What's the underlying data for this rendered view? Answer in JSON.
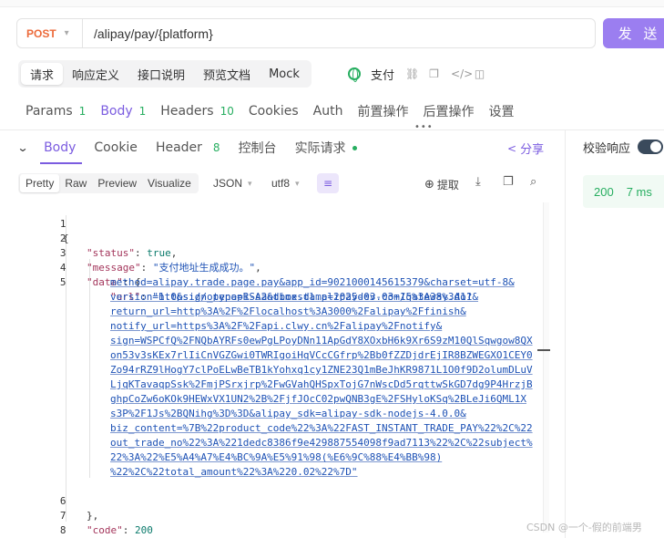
{
  "request": {
    "method": "POST",
    "url": "/alipay/pay/{platform}",
    "send_label": "发 送"
  },
  "primary_tabs": [
    "请求",
    "响应定义",
    "接口说明",
    "预览文档",
    "Mock"
  ],
  "primary_tools": {
    "env_label": "支付"
  },
  "request_tabs": [
    {
      "label": "Params",
      "count": "1"
    },
    {
      "label": "Body",
      "count": "1"
    },
    {
      "label": "Headers",
      "count": "10"
    },
    {
      "label": "Cookies",
      "count": ""
    },
    {
      "label": "Auth",
      "count": ""
    },
    {
      "label": "前置操作",
      "count": ""
    },
    {
      "label": "后置操作",
      "count": ""
    },
    {
      "label": "设置",
      "count": ""
    }
  ],
  "response_tabs": [
    {
      "label": "Body",
      "count": ""
    },
    {
      "label": "Cookie",
      "count": ""
    },
    {
      "label": "Header",
      "count": "8"
    },
    {
      "label": "控制台",
      "count": ""
    },
    {
      "label": "实际请求",
      "count": ""
    }
  ],
  "share_label": "分享",
  "validate": {
    "label": "校验响应",
    "enabled": true
  },
  "stats": {
    "status": "200",
    "time": "7 ms"
  },
  "format_tabs": [
    "Pretty",
    "Raw",
    "Preview",
    "Visualize"
  ],
  "format_select": {
    "format": "JSON",
    "encoding": "utf8"
  },
  "extract_label": "提取",
  "code": {
    "line_numbers": [
      "1",
      "2",
      "3",
      "4",
      "5",
      "6",
      "7",
      "8"
    ],
    "open_brace": "{",
    "status_key": "\"status\"",
    "status_val": "true",
    "message_key": "\"message\"",
    "message_val": "\"支付地址生成成功。\"",
    "data_key": "\"data\"",
    "url_key": "\"url\"",
    "url_lines": [
      "\"https://openapi-sandbox.dl.alipaydev.com/gateway.do?",
      "method=alipay.trade.page.pay&app_id=9021000145615379&charset=utf-8&",
      "version=1.0&sign_type=RSA2&timestamp=2025-03-03+15%3A38%3A11&",
      "return_url=http%3A%2F%2Flocalhost%3A3000%2Falipay%2Ffinish&",
      "notify_url=https%3A%2F%2Fapi.clwy.cn%2Falipay%2Fnotify&",
      "sign=WSPCfQ%2FNQbAYRFs0ewPgLPoyDNn11ApGdY8XOxbH6k9Xr6S9zM10QlSqwgow8QX",
      "on53v3sKEx7rlIiCnVGZGwi0TWRIgoiHqVCcCGfrp%2Bb0fZZDjdrEjIR8BZWEGXO1CEY0",
      "Zo94rRZ9lHogY7clPoELwBeTB1kYohxq1cy1ZNE23Q1mBeJhKR9871L1O0f9D2olumDLuV",
      "LjqKTavaqpSsk%2FmjPSrxjrp%2FwGVahQHSpxTojG7nWscDd5rqttwSkGD7dg9P4HrzjB",
      "ghpCoZw6oKOk9HEWxVX1UN2%2B%2FjfJOcC02pwQNB3gE%2FSHyloKSq%2BLeJi6QML1X",
      "s3P%2F1Js%2BQNihg%3D%3D&alipay_sdk=alipay-sdk-nodejs-4.0.0&",
      "biz_content=%7B%22product_code%22%3A%22FAST_INSTANT_TRADE_PAY%22%2C%22",
      "out_trade_no%22%3A%221dedc8386f9e429887554098f9ad7113%22%2C%22subject%",
      "22%3A%22%E5%A4%A7%E4%BC%9A%E5%91%98(%E6%9C%88%E4%BB%98)",
      "%22%2C%22total_amount%22%3A%220.02%22%7D\""
    ],
    "close_data": "},",
    "code_key": "\"code\"",
    "code_val": "200",
    "close_brace": "}"
  },
  "watermark": "CSDN @一个-假的前端男",
  "colors": {
    "accent": "#7b5ce0",
    "method": "#ec6a3a",
    "success": "#27ae60",
    "send": "#9b7ef0"
  }
}
